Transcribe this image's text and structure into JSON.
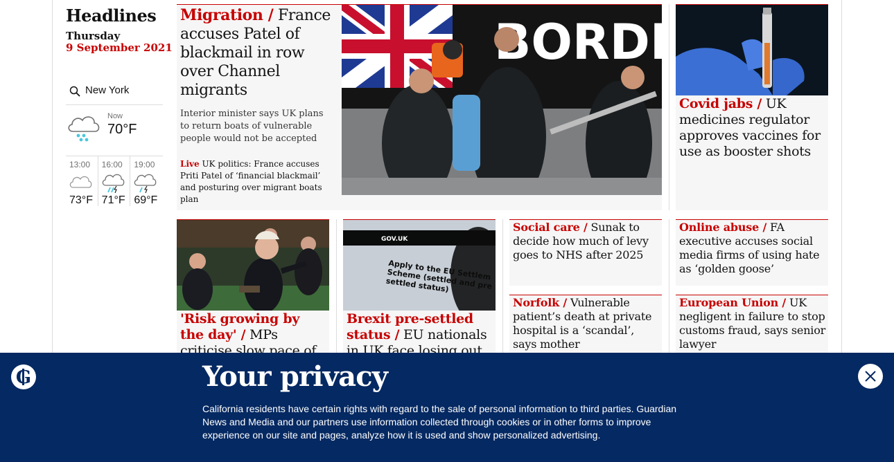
{
  "headlines": {
    "title": "Headlines",
    "day": "Thursday",
    "date": "9 September 2021"
  },
  "weather": {
    "location": "New York",
    "now_label": "Now",
    "now_temp": "70°F",
    "forecast": [
      {
        "time": "13:00",
        "temp": "73°F",
        "icon": "cloud-icon"
      },
      {
        "time": "16:00",
        "temp": "71°F",
        "icon": "rain-cloud-icon"
      },
      {
        "time": "19:00",
        "temp": "69°F",
        "icon": "rain-cloud-icon"
      }
    ]
  },
  "main_story": {
    "kicker": "Migration /",
    "headline": "France accuses Patel of blackmail in row over Channel migrants",
    "standfirst": "Interior minister says UK plans to return boats of vulnerable people would not be accepted",
    "live_label": "Live",
    "live_text": "UK politics: France accuses Priti Patel of ‘financial blackmail’ and posturing over migrant boats plan",
    "image_alt": "Border Force officers carrying child off boat"
  },
  "covid_story": {
    "kicker": "Covid jabs /",
    "headline": "UK medicines regulator approves vaccines for use as booster shots"
  },
  "row2": [
    {
      "kicker": "'Risk growing by the day' /",
      "headline": "MPs criticise slow pace of dealing"
    },
    {
      "kicker": "Brexit pre-settled status /",
      "headline": "EU nationals in UK face losing out"
    },
    {
      "kicker": "Social care /",
      "headline": "Sunak to decide how much of levy goes to NHS after 2025"
    },
    {
      "kicker": "Online abuse /",
      "headline": "FA executive accuses social media firms of using hate as ‘golden goose’"
    },
    {
      "kicker": "Norfolk /",
      "headline": "Vulnerable patient’s death at private hospital is a ‘scandal’, says mother"
    },
    {
      "kicker": "European Union /",
      "headline": "UK negligent in failure to stop customs fraud, says senior lawyer"
    }
  ],
  "gov_image_text": {
    "brand": "GOV.UK",
    "line1": "Apply to the EU Settlem",
    "line2": "Scheme (settled and pre",
    "line3": "settled status)"
  },
  "border_sign": "BORDE",
  "privacy": {
    "title": "Your privacy",
    "text": "California residents have certain rights with regard to the sale of personal information to third parties. Guardian News and Media and our partners use information collected through cookies or in other forms to improve experience on our site and pages, analyze how it is used and show personalized advertising."
  },
  "colors": {
    "accent": "#c70000",
    "banner": "#052962"
  }
}
